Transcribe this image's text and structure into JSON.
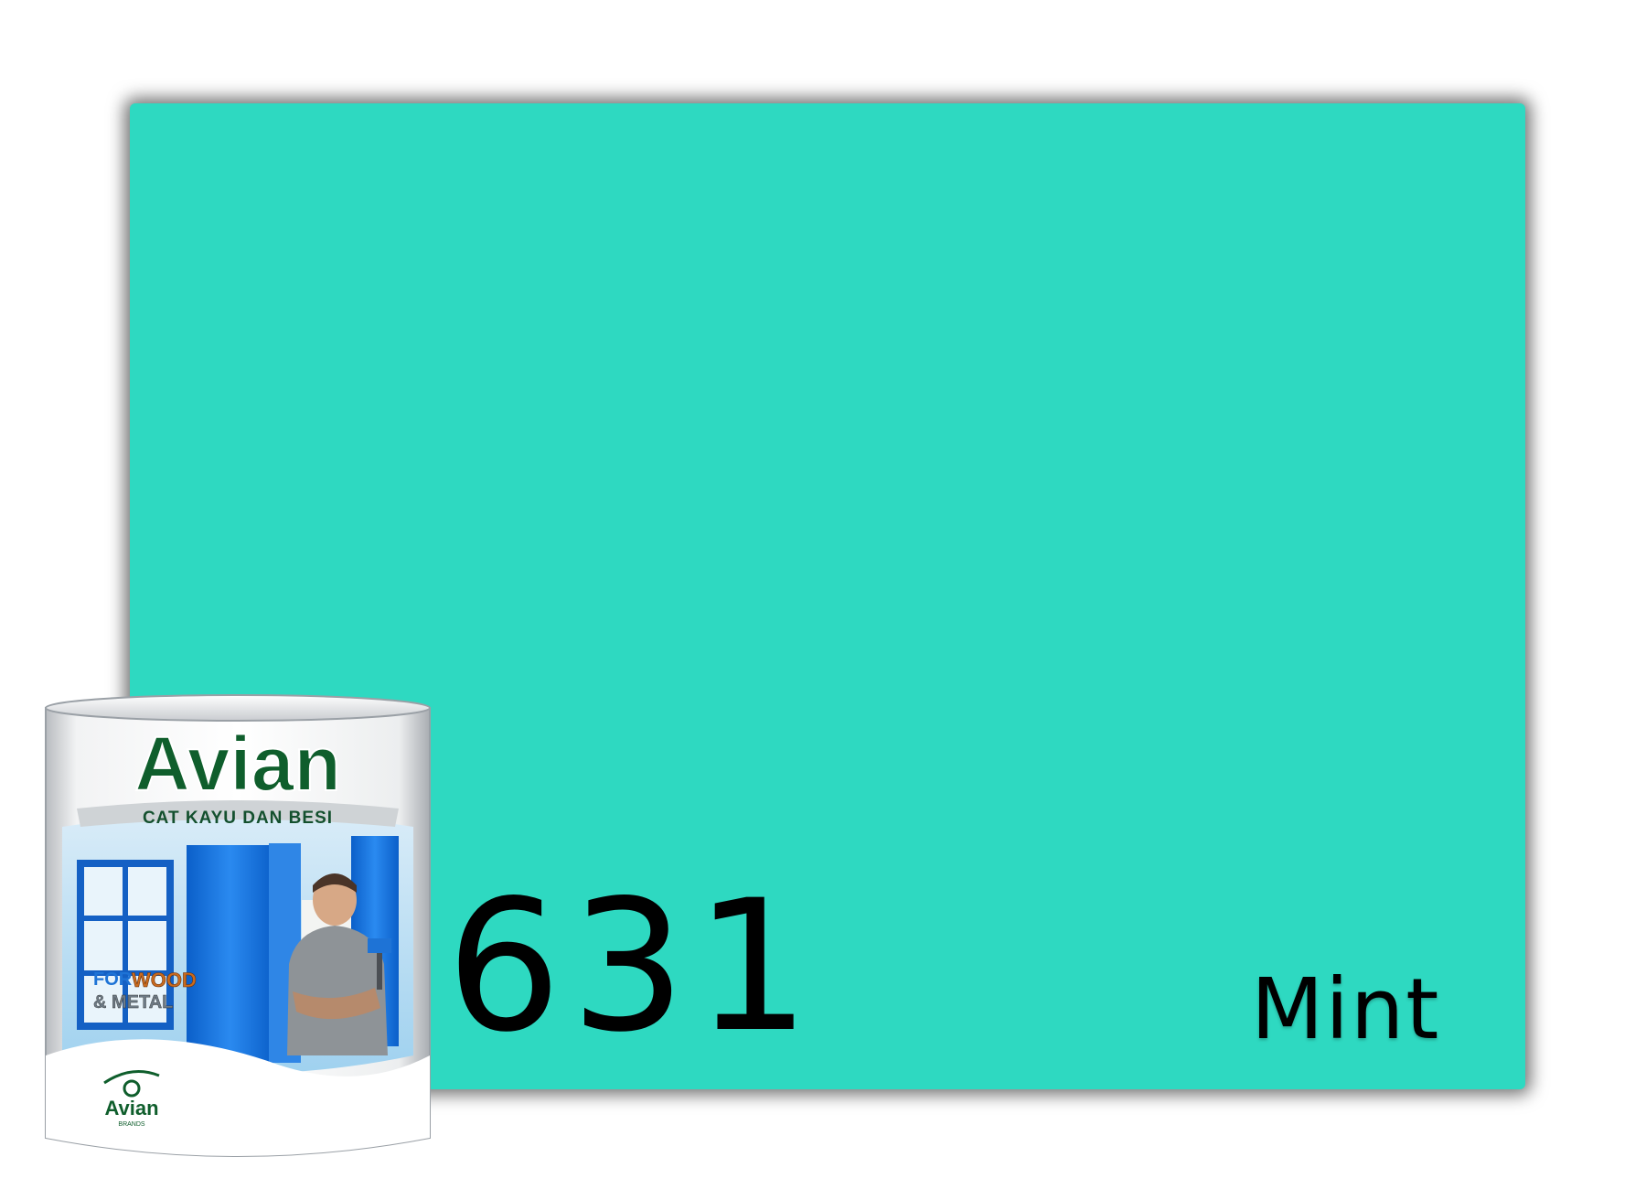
{
  "swatch": {
    "color": "#2ed9c1",
    "code": "631",
    "name": "Mint"
  },
  "can": {
    "brand": "Avian",
    "subtitle": "CAT KAYU DAN BESI",
    "badge_for": "FOR",
    "badge_wood": "WOOD",
    "badge_metal": "& METAL",
    "logo_text": "Avian",
    "logo_small": "BRANDS",
    "brand_color": "#0f5e2c",
    "accent_color": "#1e73d6"
  }
}
